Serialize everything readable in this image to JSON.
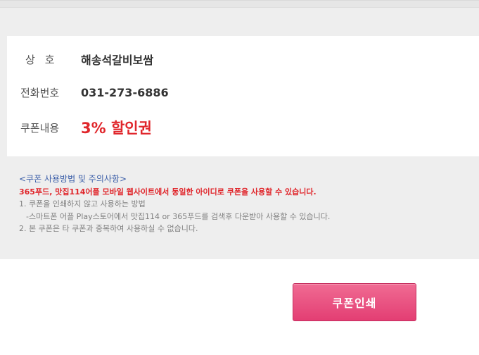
{
  "info": {
    "rows": [
      {
        "label": "상호",
        "value": "해송석갈비보쌈"
      },
      {
        "label": "전화번호",
        "value": "031-273-6886"
      },
      {
        "label": "쿠폰내용",
        "value": "3% 할인권"
      }
    ]
  },
  "notes": {
    "title": "<쿠폰 사용방법 및 주의사항>",
    "warning": "365푸드, 맛집114어플 모바일 웹사이트에서 동일한 아이디로 쿠폰을 사용할 수 있습니다.",
    "line1": "1. 쿠폰을 인쇄하지 않고 사용하는 방법",
    "line1_detail": "-스마트폰 어플 Play스토어에서 맛집114 or 365푸드를 검색후 다운받아 사용할 수 있습니다.",
    "line2": "2. 본 쿠폰은 타 쿠폰과 중복하여 사용하실 수 없습니다."
  },
  "actions": {
    "print_label": "쿠폰인쇄"
  },
  "colors": {
    "accent_red": "#e0262b",
    "note_title_blue": "#3b5ea8",
    "button_pink": "#e8487a"
  }
}
